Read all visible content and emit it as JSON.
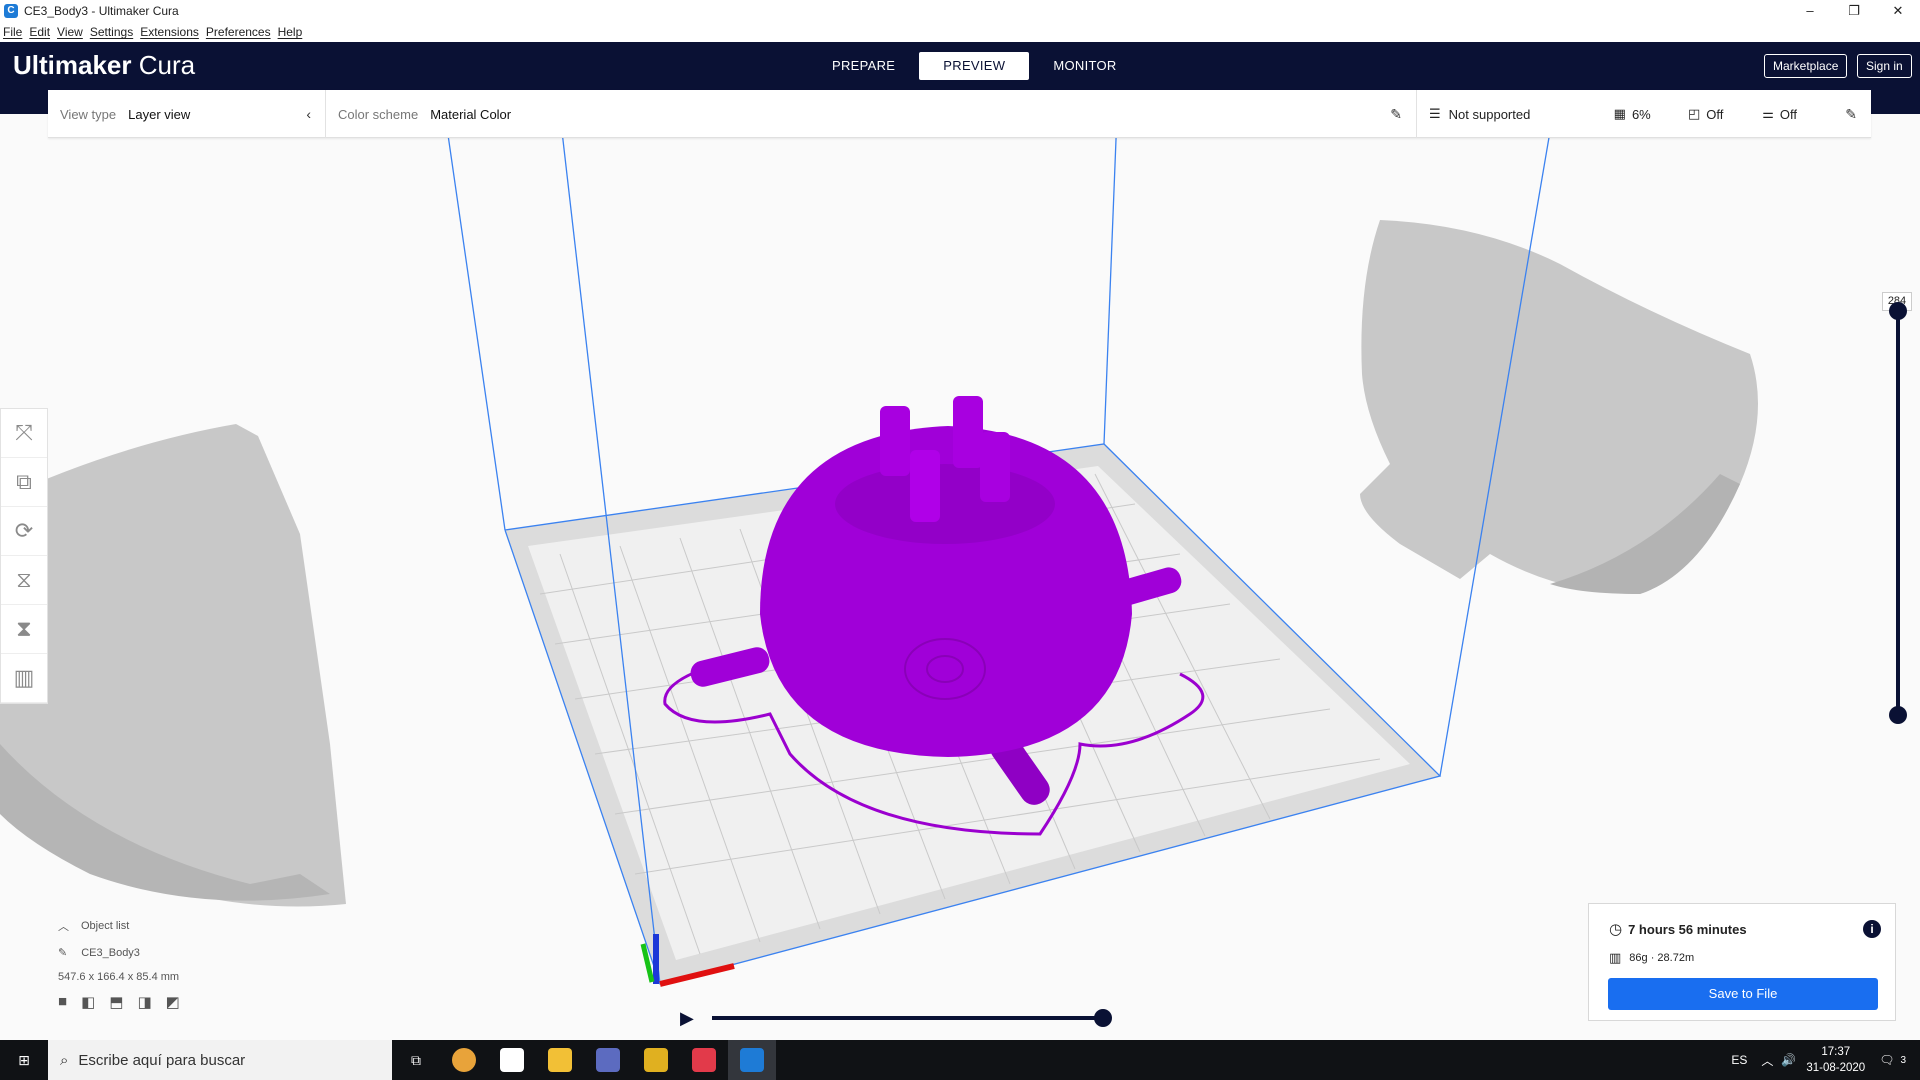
{
  "window": {
    "title": "CE3_Body3 - Ultimaker Cura",
    "controls": [
      "–",
      "❐",
      "✕"
    ]
  },
  "menu": [
    "File",
    "Edit",
    "View",
    "Settings",
    "Extensions",
    "Preferences",
    "Help"
  ],
  "header": {
    "logo_bold": "Ultimaker",
    "logo_light": " Cura",
    "stages": [
      "PREPARE",
      "PREVIEW",
      "MONITOR"
    ],
    "active_stage": "PREVIEW",
    "marketplace": "Marketplace",
    "sign_in": "Sign in"
  },
  "toolbar": {
    "view_type_label": "View type",
    "view_type_value": "Layer view",
    "color_scheme_label": "Color scheme",
    "color_scheme_value": "Material Color",
    "support": "Not supported",
    "infill": "6%",
    "adhesion": "Off",
    "support_toggle": "Off"
  },
  "layer_slider": {
    "current_layer": "284"
  },
  "object_panel": {
    "title": "Object list",
    "object_name": "CE3_Body3",
    "dimensions": "547.6 x 166.4 x 85.4 mm"
  },
  "print_info": {
    "time": "7 hours 56 minutes",
    "material": "86g · 28.72m",
    "save_label": "Save to File"
  },
  "taskbar": {
    "search_placeholder": "Escribe aquí para buscar",
    "language": "ES",
    "time": "17:37",
    "date": "31-08-2020",
    "notifications": "3"
  },
  "colors": {
    "header": "#0a1134",
    "accent": "#196ef0",
    "model": "#a000d8",
    "ghost": "#c4c4c4"
  }
}
